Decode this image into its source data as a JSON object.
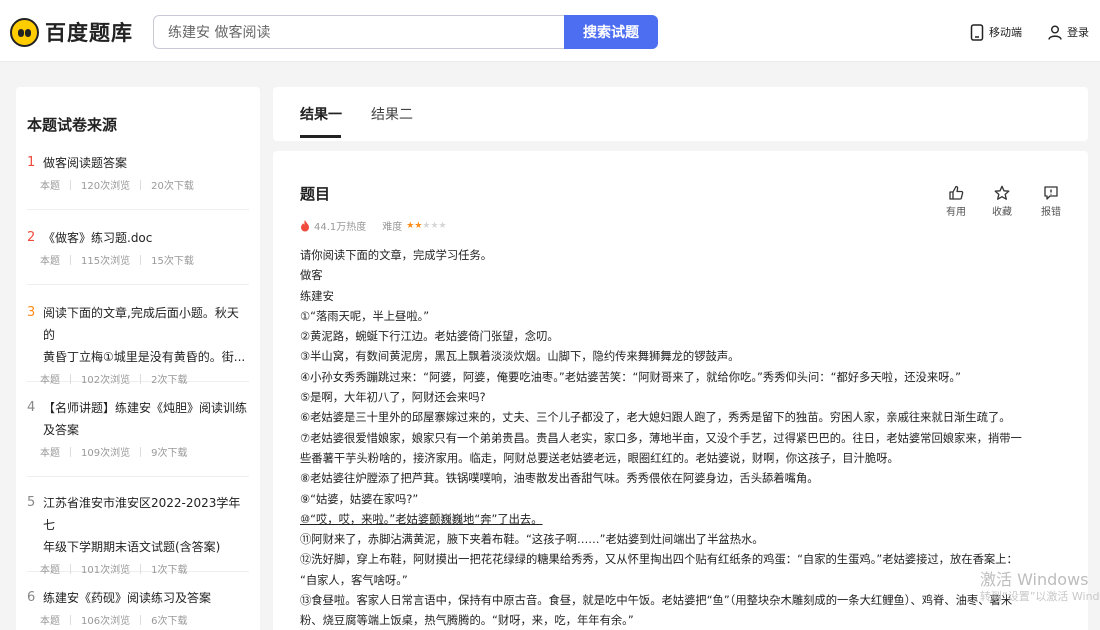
{
  "header": {
    "logo_text": "百度题库",
    "search_value": "练建安 做客阅读",
    "search_button": "搜索试题",
    "mobile_label": "移动端",
    "login_label": "登录"
  },
  "sidebar": {
    "title": "本题试卷来源",
    "items": [
      {
        "num": "1",
        "title": "做客阅读题答案",
        "tag": "本题",
        "views": "120次浏览",
        "downloads": "20次下载"
      },
      {
        "num": "2",
        "title": "《做客》练习题.doc",
        "tag": "本题",
        "views": "115次浏览",
        "downloads": "15次下载"
      },
      {
        "num": "3",
        "title_line1": "阅读下面的文章,完成后面小题。秋天的",
        "title_line2": "黄昏丁立梅①城里是没有黄昏的。街...",
        "tag": "本题",
        "views": "102次浏览",
        "downloads": "2次下载"
      },
      {
        "num": "4",
        "title_line1": "【名师讲题】练建安《炖胆》阅读训练",
        "title_line2": "及答案",
        "tag": "本题",
        "views": "109次浏览",
        "downloads": "9次下载"
      },
      {
        "num": "5",
        "title_line1": "江苏省淮安市淮安区2022-2023学年七",
        "title_line2": "年级下学期期末语文试题(含答案)",
        "tag": "本题",
        "views": "101次浏览",
        "downloads": "1次下载"
      },
      {
        "num": "6",
        "title": "练建安《药砚》阅读练习及答案",
        "tag": "本题",
        "views": "106次浏览",
        "downloads": "6次下载"
      }
    ]
  },
  "tabs": [
    "结果一",
    "结果二"
  ],
  "question": {
    "title": "题目",
    "heat": "44.1万热度",
    "difficulty_label": "难度",
    "difficulty_stars": 2,
    "difficulty_max": 5,
    "actions": {
      "useful": "有用",
      "favorite": "收藏",
      "report": "报错"
    },
    "lines": [
      "请你阅读下面的文章，完成学习任务。",
      "做客",
      "练建安",
      "①“落雨天呢，半上昼啦。”",
      "②黄泥路，蜿蜒下行江边。老姑婆倚门张望，念叨。",
      "③半山窝，有数间黄泥房，黑瓦上飘着淡淡炊烟。山脚下，隐约传来舞狮舞龙的锣鼓声。",
      "④小孙女秀秀蹦跳过来：“阿婆，阿婆，俺要吃油枣。”老姑婆苦笑：“阿财哥来了，就给你吃。”秀秀仰头问：“都好多天啦，还没来呀。”",
      "⑤是啊，大年初八了，阿财还会来吗?",
      "⑥老姑婆是三十里外的邱屋寨嫁过来的，丈夫、三个儿子都没了，老大媳妇跟人跑了，秀秀是留下的独苗。穷困人家，亲戚往来就日渐生疏了。",
      "⑦老姑婆很爱惜娘家，娘家只有一个弟弟贵昌。贵昌人老实，家口多，薄地半亩，又没个手艺，过得紧巴巴的。往日，老姑婆常回娘家来，捎带一",
      "些番薯干芋头粉啥的，接济家用。临走，阿财总要送老姑婆老远，眼圈红红的。老姑婆说，财啊，你这孩子，目汁脆呀。",
      "⑧老姑婆往炉膛添了把芦萁。铁锅噗噗响，油枣散发出香甜气味。秀秀偎依在阿婆身边，舌头舔着嘴角。",
      "⑨“姑婆，姑婆在家吗?”",
      "⑩“哎，哎，来啦。”老姑婆颤巍巍地“奔”了出去。",
      "⑪阿财来了，赤脚沾满黄泥，腋下夹着布鞋。“这孩子啊……”老姑婆到灶间端出了半盆热水。",
      "⑫洗好脚，穿上布鞋，阿财摸出一把花花绿绿的糖果给秀秀，又从怀里掏出四个贴有红纸条的鸡蛋：“自家的生蛋鸡。”老姑婆接过，放在香案上：",
      "“自家人，客气啥呀。”",
      "⑬食昼啦。客家人日常言语中，保持有中原古音。食昼，就是吃中午饭。老姑婆把“鱼”（用整块杂木雕刻成的一条大红鲤鱼）、鸡脊、油枣、薯米",
      "粉、烧豆腐等端上饭桌，热气腾腾的。“财呀，来，吃，年年有余。”"
    ]
  },
  "watermark": {
    "line1": "激活 Windows",
    "line2": "转到“设置”以激活 Windows。"
  },
  "colors": {
    "brand_blue": "#4e6ef2",
    "rank_red": "#f04b3c",
    "rank_orange": "#ff8c1a",
    "heat_red": "#f04b3c"
  }
}
